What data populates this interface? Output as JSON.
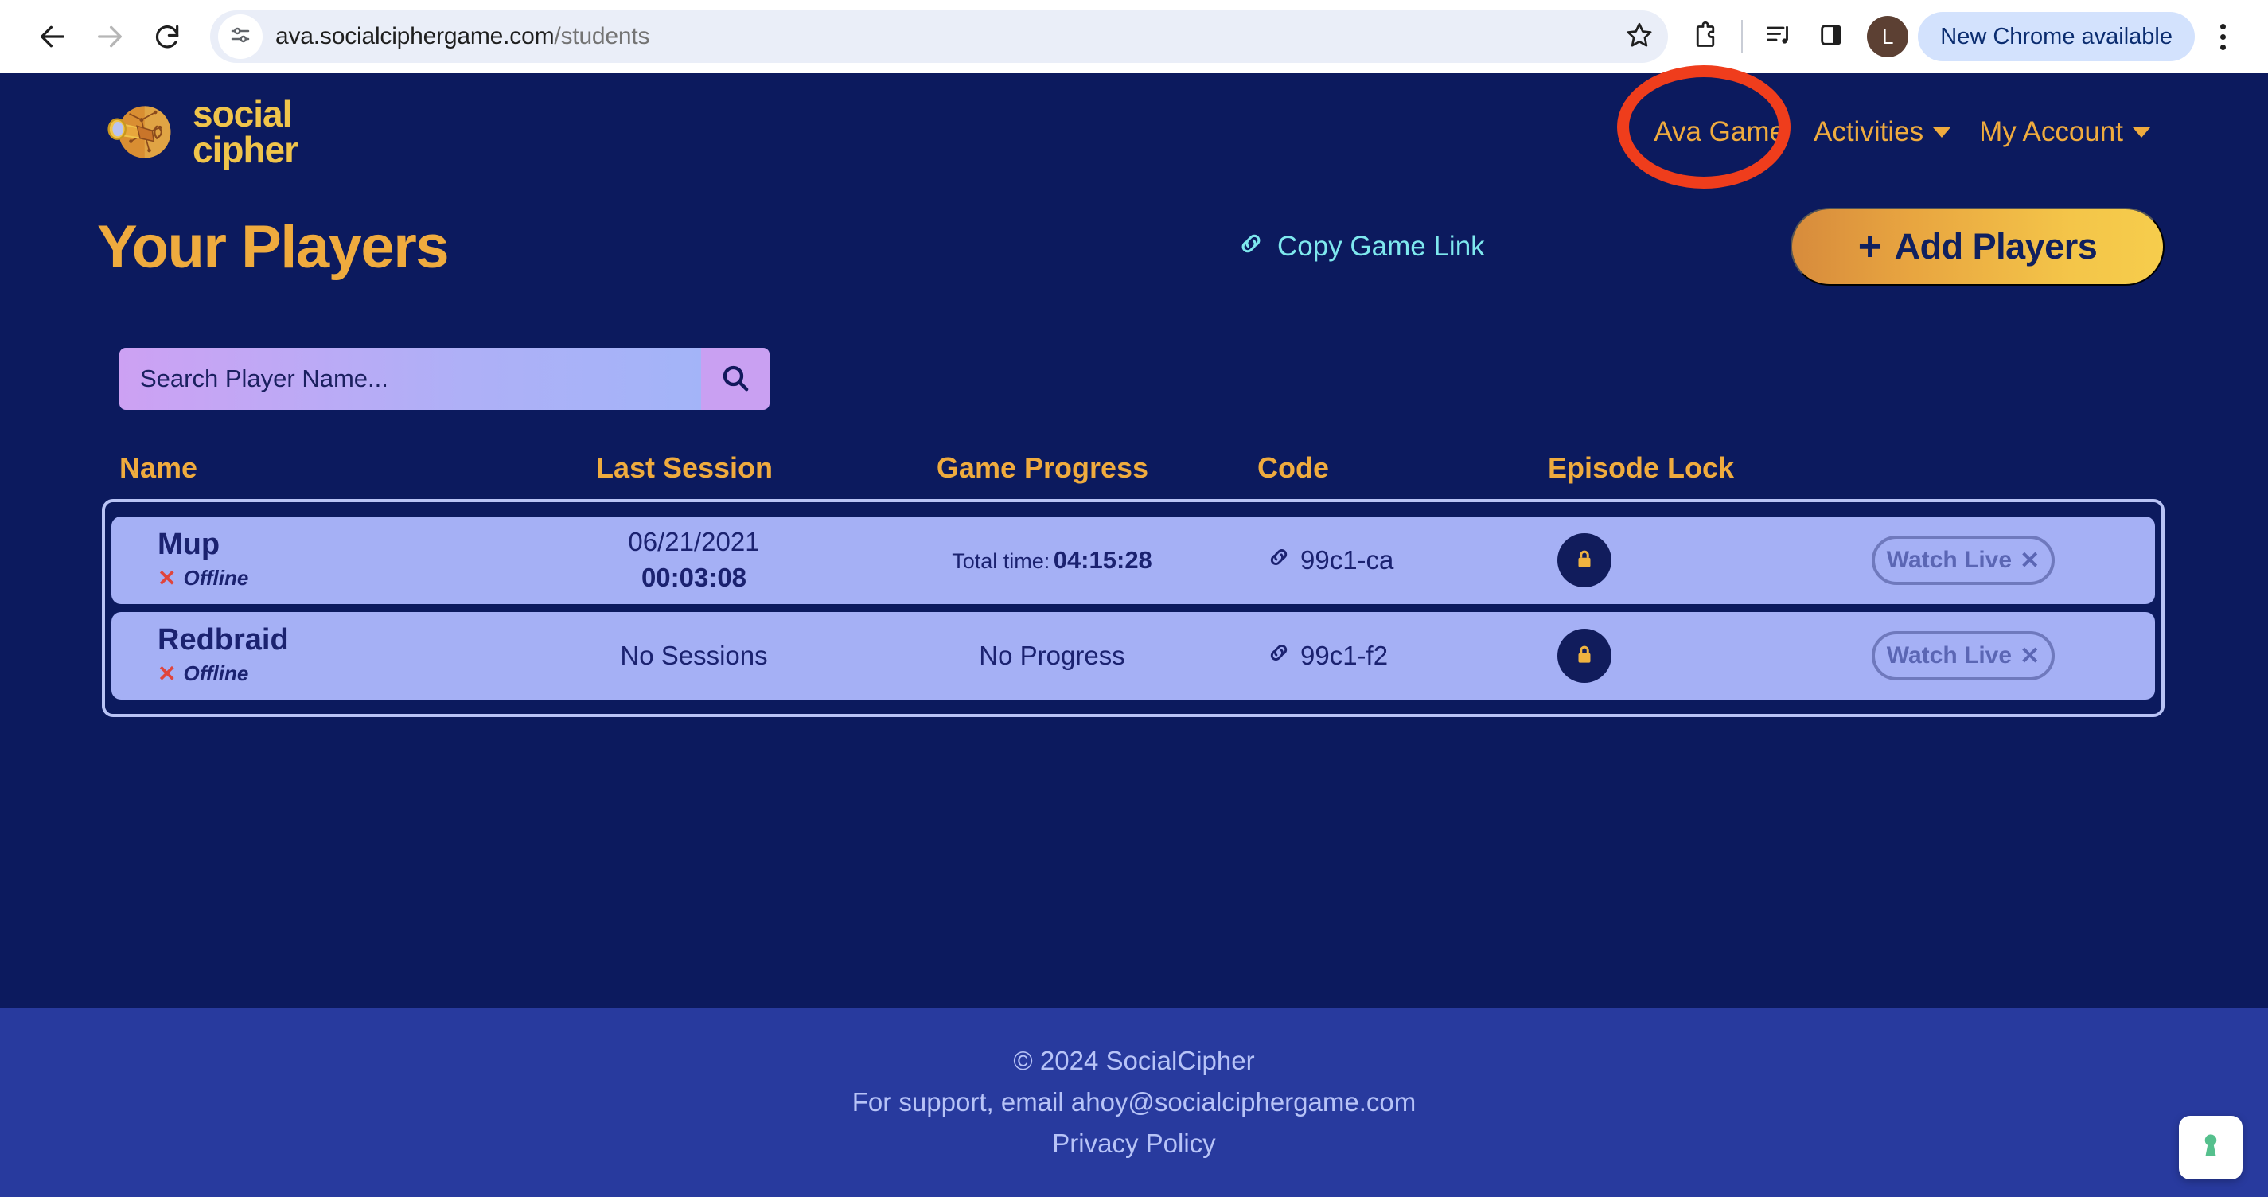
{
  "browser": {
    "back_icon": "back-arrow-icon",
    "forward_icon": "forward-arrow-icon",
    "reload_icon": "reload-icon",
    "site_info_icon": "site-settings-icon",
    "url_host": "ava.socialciphergame.com",
    "url_path": "/students",
    "bookmark_icon": "star-icon",
    "extensions_icon": "extensions-puzzle-icon",
    "media_icon": "media-list-icon",
    "sidepanel_icon": "side-panel-icon",
    "profile_initial": "L",
    "update_pill_label": "New Chrome available",
    "menu_icon": "three-dot-menu-icon"
  },
  "header": {
    "brand_line1": "social",
    "brand_line2": "cipher",
    "brand_icon": "telescope-logo-icon",
    "nav": [
      {
        "label": "Ava Game",
        "has_caret": false,
        "highlighted": true
      },
      {
        "label": "Activities",
        "has_caret": true,
        "highlighted": false
      },
      {
        "label": "My Account",
        "has_caret": true,
        "highlighted": false
      }
    ],
    "annotation_color": "#ef3d1c"
  },
  "title_row": {
    "title": "Your Players",
    "copy_link_label": "Copy Game Link",
    "copy_link_icon": "link-icon",
    "copy_link_color": "#7ee8ee",
    "add_players_label": "Add Players",
    "add_players_plus": "+"
  },
  "search": {
    "placeholder": "Search Player Name...",
    "value": "",
    "button_icon": "search-icon"
  },
  "table": {
    "columns": [
      "Name",
      "Last Session",
      "Game Progress",
      "Code",
      "Episode Lock",
      ""
    ],
    "rows": [
      {
        "name": "Mup",
        "status": "Offline",
        "status_mark": "✕",
        "session_date": "06/21/2021",
        "session_time": "00:03:08",
        "session_none": "",
        "progress_label": "Total time:",
        "progress_value": "04:15:28",
        "progress_none": "",
        "code": "99c1-ca",
        "code_icon": "link-icon",
        "lock_icon": "lock-icon",
        "action_label": "Watch Live",
        "action_x": "✕"
      },
      {
        "name": "Redbraid",
        "status": "Offline",
        "status_mark": "✕",
        "session_date": "",
        "session_time": "",
        "session_none": "No Sessions",
        "progress_label": "",
        "progress_value": "",
        "progress_none": "No Progress",
        "code": "99c1-f2",
        "code_icon": "link-icon",
        "lock_icon": "lock-icon",
        "action_label": "Watch Live",
        "action_x": "✕"
      }
    ]
  },
  "footer": {
    "copyright": "© 2024 SocialCipher",
    "support": "For support, email ahoy@socialciphergame.com",
    "privacy": "Privacy Policy"
  },
  "support_widget": {
    "icon": "keyhole-icon",
    "color": "#55c08d"
  },
  "theme": {
    "page_bg": "#0c1a5e",
    "footer_bg": "#283a9e",
    "accent_gold": "#efab3e",
    "row_bg": "#a5b0f5"
  }
}
